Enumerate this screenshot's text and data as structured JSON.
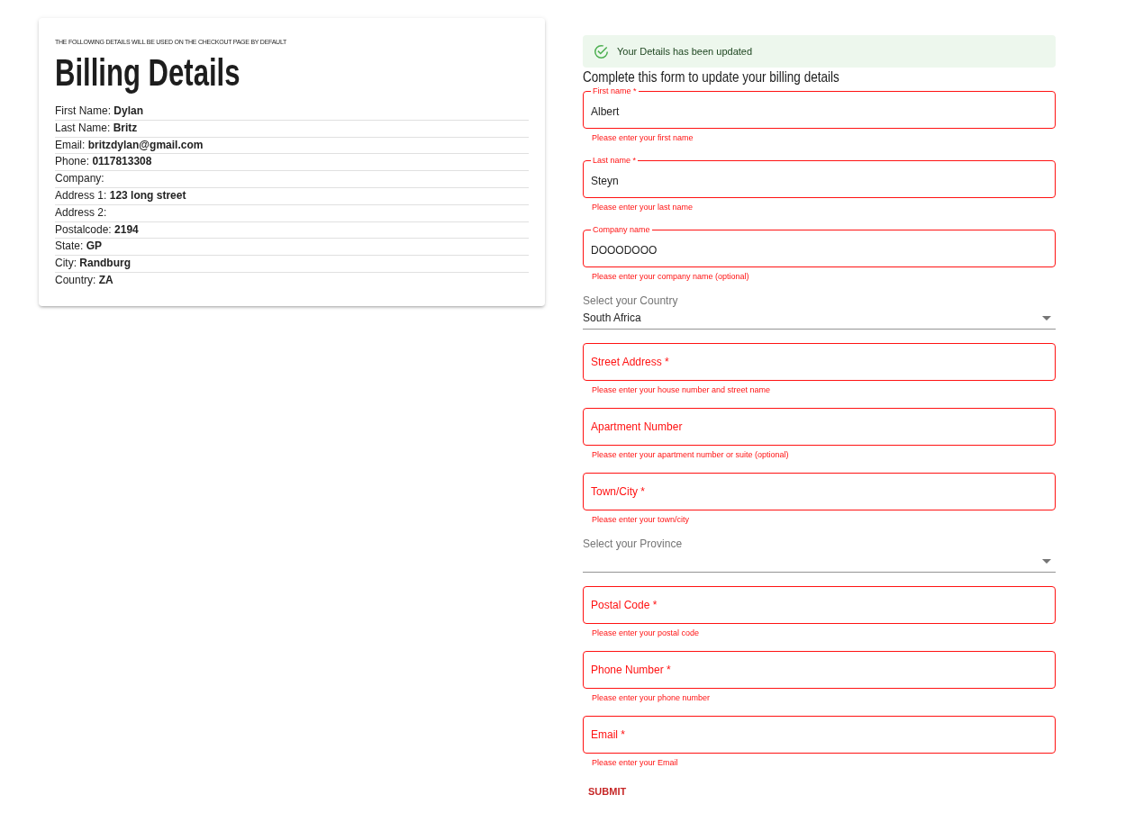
{
  "billing_card": {
    "caption": "THE FOLLOWING DETAILS WILL BE USED ON THE CHECKOUT PAGE BY DEFAULT",
    "title": "Billing Details",
    "rows": [
      {
        "label": "First Name:",
        "value": "Dylan"
      },
      {
        "label": "Last Name:",
        "value": "Britz"
      },
      {
        "label": "Email:",
        "value": "britzdylan@gmail.com"
      },
      {
        "label": "Phone:",
        "value": "0117813308"
      },
      {
        "label": "Company:"
      },
      {
        "label": "Address 1:",
        "value": "123 long street"
      },
      {
        "label": "Address 2:"
      },
      {
        "label": "Postalcode:",
        "value": "2194"
      },
      {
        "label": "State:",
        "value": "GP"
      },
      {
        "label": "City:",
        "value": "Randburg"
      },
      {
        "label": "Country:",
        "value": "ZA"
      }
    ]
  },
  "form": {
    "alert": {
      "text": "Your Details has been updated"
    },
    "heading": "Complete this form to update your billing details",
    "fields": [
      {
        "kind": "text",
        "label": "First name *",
        "value": "Albert",
        "helper": "Please enter your first name",
        "error": true
      },
      {
        "kind": "text",
        "label": "Last name *",
        "value": "Steyn",
        "helper": "Please enter your last name",
        "error": true
      },
      {
        "kind": "text",
        "label": "Company name",
        "value": "DOOODOOO",
        "helper": "Please enter your company name (optional)",
        "error": true
      },
      {
        "kind": "select",
        "label": "Select your Country",
        "value": "South Africa"
      },
      {
        "kind": "text",
        "label": "Street Address *",
        "helper": "Please enter your house number and street name",
        "error": true
      },
      {
        "kind": "text",
        "label": "Apartment Number",
        "helper": "Please enter your apartment number or suite (optional)",
        "error": true
      },
      {
        "kind": "text",
        "label": "Town/City *",
        "helper": "Please enter your town/city",
        "error": true
      },
      {
        "kind": "select",
        "label": "Select your Province"
      },
      {
        "kind": "text",
        "label": "Postal Code *",
        "helper": "Please enter your postal code",
        "error": true
      },
      {
        "kind": "text",
        "label": "Phone Number *",
        "helper": "Please enter your phone number",
        "error": true
      },
      {
        "kind": "text",
        "label": "Email *",
        "helper": "Please enter your Email",
        "error": true
      }
    ],
    "submit": "SUBMIT"
  }
}
